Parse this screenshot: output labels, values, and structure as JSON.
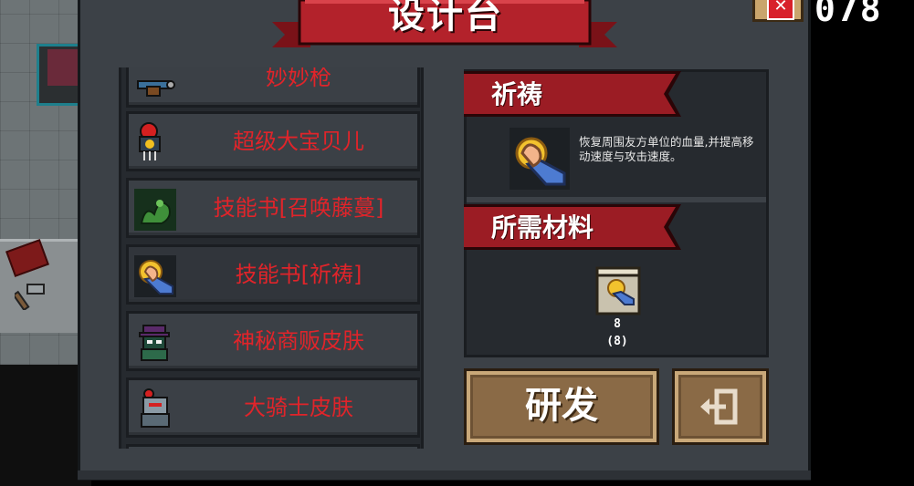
{
  "window": {
    "title": "设计台",
    "counter": "078"
  },
  "recipe_list": {
    "items": [
      {
        "label": "妙妙枪",
        "icon": "gun-icon",
        "selected": false
      },
      {
        "label": "超级大宝贝儿",
        "icon": "robot-pet-icon",
        "selected": false
      },
      {
        "label": "技能书[召唤藤蔓]",
        "icon": "vine-skillbook-icon",
        "selected": false
      },
      {
        "label": "技能书[祈祷]",
        "icon": "prayer-skillbook-icon",
        "selected": true
      },
      {
        "label": "神秘商贩皮肤",
        "icon": "merchant-skin-icon",
        "selected": false
      },
      {
        "label": "大骑士皮肤",
        "icon": "knight-skin-icon",
        "selected": false
      }
    ]
  },
  "detail": {
    "name": "祈祷",
    "description": "恢复周围友方单位的血量,并提高移动速度与攻击速度。",
    "materials_header": "所需材料",
    "material": {
      "icon": "prayer-scroll-icon",
      "required": "8",
      "owned": "(8)"
    }
  },
  "actions": {
    "research_label": "研发",
    "exit_icon": "exit-icon"
  },
  "colors": {
    "panel": "#3c4147",
    "ribbon": "#9b1c24",
    "item_text": "#e0242a",
    "button": "#8a6a46"
  }
}
